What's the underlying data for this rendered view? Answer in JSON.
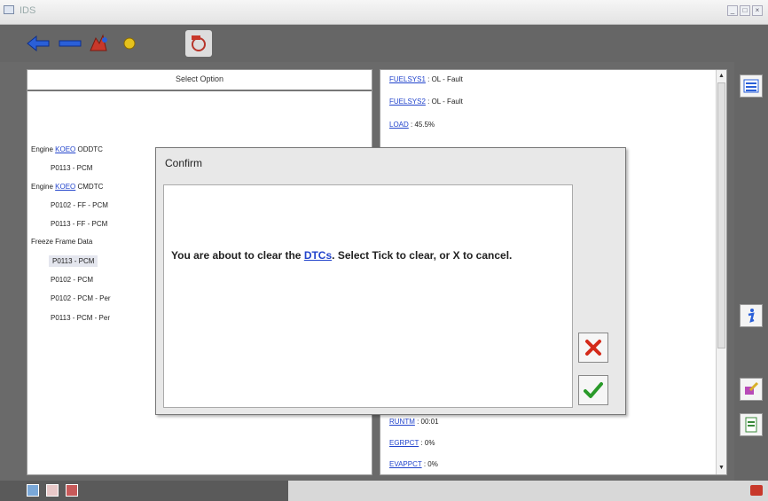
{
  "window": {
    "title": "IDS"
  },
  "left_panel": {
    "header": "Select Option",
    "lines": [
      {
        "prefix": "Engine ",
        "link": "KOEO",
        "suffix": " ODDTC"
      },
      {
        "text": "P0113 - PCM"
      },
      {
        "prefix": "Engine ",
        "link": "KOEO",
        "suffix": " CMDTC"
      },
      {
        "text": "P0102 - FF - PCM"
      },
      {
        "text": "P0113 - FF - PCM"
      },
      {
        "text": "Freeze Frame Data"
      },
      {
        "text": "P0113 - PCM"
      },
      {
        "text": "P0102 - PCM"
      },
      {
        "text": "P0102 - PCM - Per"
      },
      {
        "text": "P0113 - PCM - Per"
      }
    ]
  },
  "right_panel": {
    "pids": [
      {
        "name": "FUELSYS1",
        "value": " : OL - Fault"
      },
      {
        "name": "FUELSYS2",
        "value": " : OL - Fault"
      },
      {
        "name": "LOAD",
        "value": " : 45.5%"
      },
      {
        "name": "RUNTM",
        "value": " : 00:01"
      },
      {
        "name": "EGRPCT",
        "value": " : 0%"
      },
      {
        "name": "EVAPPCT",
        "value": " : 0%"
      }
    ]
  },
  "dialog": {
    "title": "Confirm",
    "message_before": "You are about to clear the ",
    "message_link": "DTCs",
    "message_after": ". Select Tick to clear, or X to cancel."
  }
}
